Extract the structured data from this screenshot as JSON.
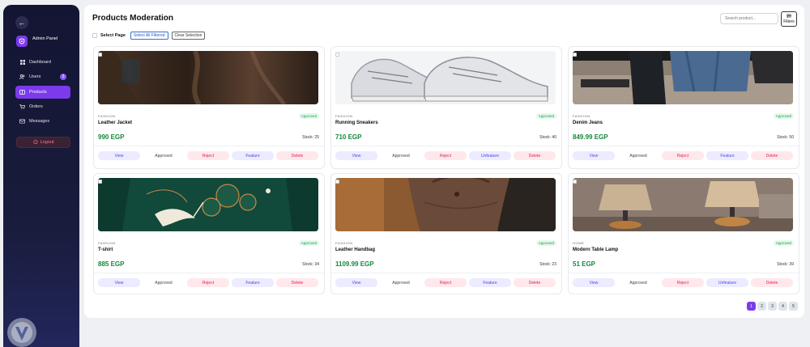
{
  "sidebar": {
    "brand_title": "Admin Panel",
    "items": [
      {
        "label": "Dashboard",
        "icon": "grid-icon"
      },
      {
        "label": "Users",
        "icon": "users-icon",
        "badge": "3"
      },
      {
        "label": "Products",
        "icon": "box-icon",
        "active": true
      },
      {
        "label": "Orders",
        "icon": "cart-icon"
      },
      {
        "label": "Messages",
        "icon": "mail-icon"
      }
    ],
    "logout_label": "Logout"
  },
  "header": {
    "title": "Products Moderation",
    "search_placeholder": "Search product...",
    "filters_label": "Filters"
  },
  "selection": {
    "select_page_label": "Select Page",
    "select_all_filtered_label": "Select All Filtered",
    "clear_selection_label": "Clear Selection"
  },
  "products": [
    {
      "category": "FASHION",
      "status": "Approved",
      "name": "Leather Jacket",
      "price": "990 EGP",
      "stock": "Stock: 25",
      "actions": [
        "View",
        "Approved",
        "Reject",
        "Feature",
        "Delete"
      ]
    },
    {
      "category": "FASHION",
      "status": "Approved",
      "name": "Running Sneakers",
      "price": "710 EGP",
      "stock": "Stock: 40",
      "actions": [
        "View",
        "Approved",
        "Reject",
        "Unfeature",
        "Delete"
      ]
    },
    {
      "category": "FASHION",
      "status": "Approved",
      "name": "Denim Jeans",
      "price": "849.99 EGP",
      "stock": "Stock: 50",
      "actions": [
        "View",
        "Approved",
        "Reject",
        "Feature",
        "Delete"
      ]
    },
    {
      "category": "FASHION",
      "status": "Approved",
      "name": "T-shirt",
      "price": "885 EGP",
      "stock": "Stock: 34",
      "actions": [
        "View",
        "Approved",
        "Reject",
        "Feature",
        "Delete"
      ]
    },
    {
      "category": "FASHION",
      "status": "Approved",
      "name": "Leather Handbag",
      "price": "1109.99 EGP",
      "stock": "Stock: 23",
      "actions": [
        "View",
        "Approved",
        "Reject",
        "Feature",
        "Delete"
      ]
    },
    {
      "category": "HOME",
      "status": "Approved",
      "name": "Modern Table Lamp",
      "price": "51 EGP",
      "stock": "Stock: 39",
      "actions": [
        "View",
        "Approved",
        "Reject",
        "Unfeature",
        "Delete"
      ]
    }
  ],
  "pagination": {
    "pages": [
      "1",
      "2",
      "3",
      "4",
      "5"
    ],
    "current": "1"
  },
  "colors": {
    "accent": "#7c3aed",
    "price": "#18853d",
    "approved": "#16a34a",
    "danger": "#e11d48",
    "sidebar": "#131533"
  }
}
